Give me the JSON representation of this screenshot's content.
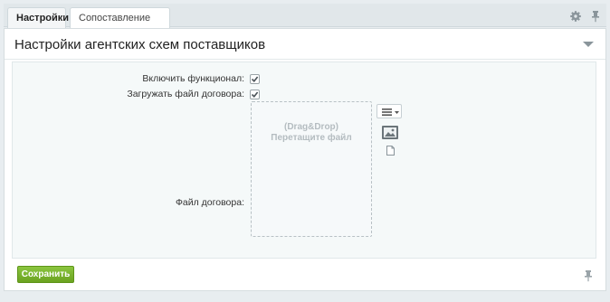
{
  "tabs": [
    {
      "label": "Настройки",
      "active": true
    },
    {
      "label": "Сопоставление полей",
      "active": false
    }
  ],
  "toolbar": {
    "gear_icon": "gear-icon",
    "pin_icon": "pin-icon"
  },
  "section": {
    "title": "Настройки агентских схем поставщиков",
    "collapse_icon": "chevron-down-icon"
  },
  "form": {
    "enable_label": "Включить функционал:",
    "enable_checked": true,
    "upload_label": "Загружать файл договора:",
    "upload_checked": true,
    "contract_label": "Файл договора:",
    "dropzone_line1": "(Drag&Drop)",
    "dropzone_line2": "Перетащите файл"
  },
  "buttons": {
    "save_label": "Сохранить"
  },
  "colors": {
    "accent_green": "#7ab32e",
    "panel_bg": "#f5f9f9"
  }
}
